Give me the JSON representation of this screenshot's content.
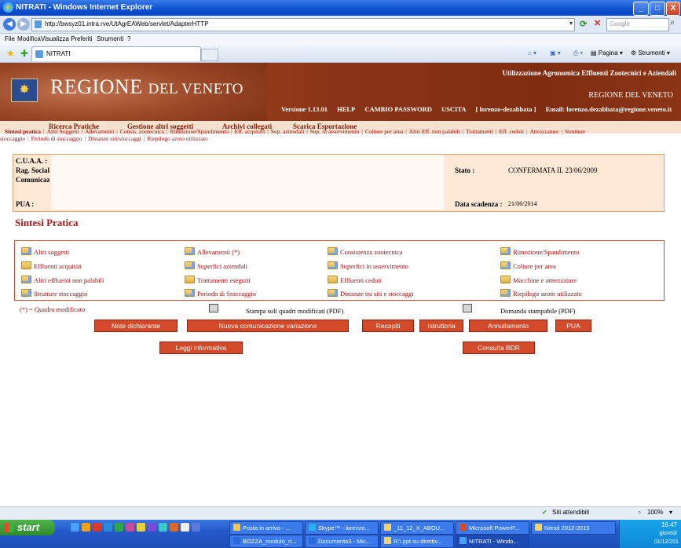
{
  "window": {
    "title": "NITRATI - Windows Internet Explorer",
    "minimize": "_",
    "maximize": "□",
    "close": "X"
  },
  "address_bar": {
    "url": "http://bwsyz01.intra.rve/UtAgrEAWeb/servlet/AdapterHTTP",
    "search_placeholder": "Google"
  },
  "menu": [
    "File",
    "Modifica",
    "Visualizza",
    "Preferiti",
    "Strumenti",
    "?"
  ],
  "tab": {
    "label": "NITRATI"
  },
  "toolbar_right": {
    "pagina": "Pagina",
    "strumenti": "Strumenti"
  },
  "header": {
    "brand": "REGIONE",
    "brand_small": "DEL VENETO",
    "subtitle": "Utilizzazione Agronomica Effluenti Zootecnici e Aziendali",
    "region": "REGIONE DEL VENETO",
    "version": "Versione 1.13.01",
    "help": "HELP",
    "change_password": "CAMBIO PASSWORD",
    "exit": "USCITA",
    "user": "[ lorenzo-dezabbata ]",
    "email": "Email: lorenzo.dezabbata@regione.veneto.it"
  },
  "main_menu": [
    "Ricerca Pratiche",
    "Gestione altri soggetti",
    "Archivi collegati",
    "Scarica Esportazione"
  ],
  "sub_links_row1": [
    "Sintesi pratica",
    "Altri Soggetti",
    "Allevamenti",
    "Consis. zootecnica",
    "Rimozione/Spandimento",
    "Eff. acquisiti",
    "Sup. aziendali",
    "Sup. in asservimento",
    "Colture per area",
    "Altri Eff. non palabili",
    "Trattamenti",
    "Eff. ceduti",
    "Attrezzature",
    "Strutture"
  ],
  "sub_links_row2": [
    "stoccaggio",
    "Periodo di stoccaggio",
    "Distanze siti/stoccaggi",
    "Riepilogo azoto utilizzato"
  ],
  "info": {
    "cuaa_label": "C.U.A.A. :",
    "rag_label": "Rag. Social",
    "comunic_label": "Comunicaz",
    "pua_label": "PUA :",
    "stato_label": "Stato :",
    "stato_value": "CONFERMATA IL 23/06/2009",
    "scadenza_label": "Data scadenza :",
    "scadenza_value": "21/06/2014"
  },
  "section_title": "Sintesi Pratica",
  "grid": [
    [
      "Altri soggetti",
      "Allevamenti (*)",
      "Consistenza zootecnica",
      "Rimozione/Spandimento"
    ],
    [
      "Effluenti acquisiti",
      "Superfici aziendali",
      "Superfici in asservimento",
      "Colture per area"
    ],
    [
      "Altri effluenti non palabili",
      "Trattamenti eseguiti",
      "Effluenti ceduti",
      "Macchine e attrezzature"
    ],
    [
      "Strutture stoccaggio",
      "Periodo di Stoccaggio",
      "Distanze tra siti e stoccaggi",
      "Riepilogo azoto utilizzato"
    ]
  ],
  "legend": {
    "modified": "(*) = Quadro modificato",
    "print_modified": "Stampa soli quadri modificati (PDF)",
    "print_request": "Domanda stampabile (PDF)"
  },
  "buttons": {
    "note": "Note dichiarante",
    "nuova": "Nuova comunicazione variazione",
    "recapiti": "Recapiti",
    "istruttoria": "Istruttoria",
    "annullamento": "Annullamento",
    "pua": "PUA",
    "leggi": "Leggi informativa",
    "bdr": "Consulta BDR"
  },
  "status_bar": {
    "zone": "Siti attendibili",
    "zoom": "100%"
  },
  "taskbar": {
    "start": "start",
    "tasks_row1": [
      "Posta in arrivo - ...",
      "Skype™ - lorenzo...",
      "_11_12_X_ABOU...",
      "Microsoft PowerP...",
      "Nitrati 2012-2015"
    ],
    "tasks_row2": [
      "BOZZA_modulo_ri...",
      "Documento3 - Mic...",
      "R:\\ ppt su direttiv...",
      "NITRATI - Windo..."
    ],
    "clock": "16.47",
    "day": "giovedì",
    "date": "01/12/201"
  }
}
